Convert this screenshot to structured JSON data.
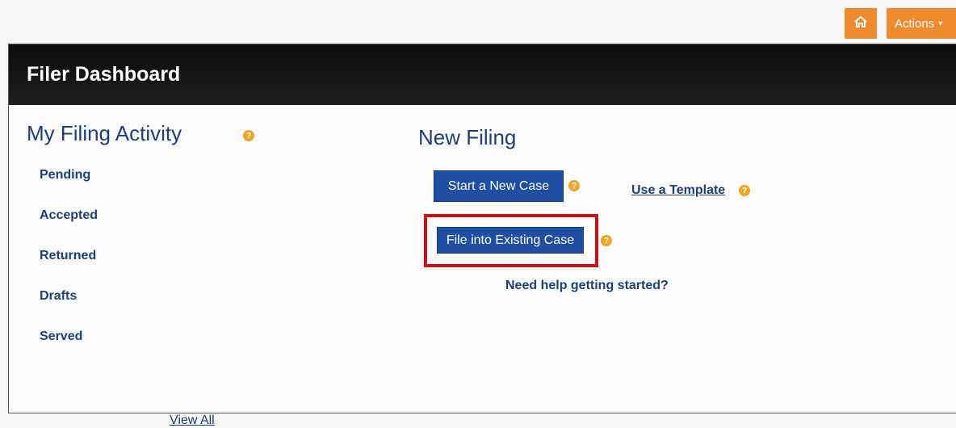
{
  "header": {
    "title": "Filer Dashboard",
    "home_icon": "home-icon",
    "actions_label": "Actions",
    "actions_icon": "chevron-down-icon"
  },
  "my_filing_activity": {
    "title": "My Filing Activity",
    "help_icon": "help-icon",
    "items": [
      {
        "label": "Pending"
      },
      {
        "label": "Accepted"
      },
      {
        "label": "Returned"
      },
      {
        "label": "Drafts"
      },
      {
        "label": "Served"
      }
    ],
    "view_all_label": "View All"
  },
  "new_filing": {
    "title": "New Filing",
    "start_new_case_label": "Start a New Case",
    "use_template_label": "Use a Template",
    "file_existing_label": "File into Existing Case",
    "help_getting_started_label": "Need help getting started?",
    "help_icon": "help-icon"
  },
  "colors": {
    "header_bg": "#151515",
    "accent_orange": "#ef8a2f",
    "button_blue": "#1f4ea3",
    "highlight_red": "#cf0e19",
    "text_blue": "#1d3f7a"
  }
}
